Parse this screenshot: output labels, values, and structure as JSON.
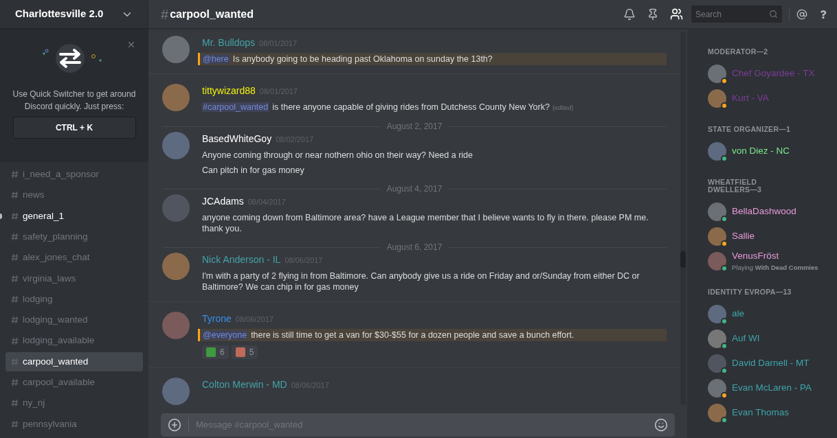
{
  "server": {
    "name": "Charlottesville 2.0"
  },
  "quick_switcher": {
    "text": "Use Quick Switcher to get around Discord quickly. Just press:",
    "shortcut": "CTRL + K"
  },
  "channels": [
    {
      "name": "i_need_a_sponsor",
      "selected": false,
      "unread": false
    },
    {
      "name": "news",
      "selected": false,
      "unread": false
    },
    {
      "name": "general_1",
      "selected": false,
      "unread": true
    },
    {
      "name": "safety_planning",
      "selected": false,
      "unread": false
    },
    {
      "name": "alex_jones_chat",
      "selected": false,
      "unread": false
    },
    {
      "name": "virginia_laws",
      "selected": false,
      "unread": false
    },
    {
      "name": "lodging",
      "selected": false,
      "unread": false
    },
    {
      "name": "lodging_wanted",
      "selected": false,
      "unread": false
    },
    {
      "name": "lodging_available",
      "selected": false,
      "unread": false
    },
    {
      "name": "carpool_wanted",
      "selected": true,
      "unread": false
    },
    {
      "name": "carpool_available",
      "selected": false,
      "unread": false
    },
    {
      "name": "ny_nj",
      "selected": false,
      "unread": false
    },
    {
      "name": "pennsylvania",
      "selected": false,
      "unread": false
    }
  ],
  "header": {
    "hash": "#",
    "channel": "carpool_wanted",
    "search_placeholder": "Search"
  },
  "messages": [
    {
      "kind": "message",
      "author": "Mr. Bulldops",
      "color": "#43a3a8",
      "timestamp": "08/01/2017",
      "lines": [
        {
          "mention": "@here",
          "text": "Is anybody going to be heading past Oklahoma on sunday the 13th?",
          "highlighted": true
        }
      ]
    },
    {
      "kind": "message",
      "author": "tittywizard88",
      "color": "#f2f20d",
      "timestamp": "08/01/2017",
      "lines": [
        {
          "mention": "#carpool_wanted",
          "text": "is there anyone capable of giving rides from Dutchess County New York?",
          "highlighted": false,
          "edited": "(edited)"
        }
      ]
    },
    {
      "kind": "divider",
      "date": "August 2, 2017"
    },
    {
      "kind": "message",
      "author": "BasedWhiteGoy",
      "color": "#ffffff",
      "timestamp": "08/02/2017",
      "lines": [
        {
          "text": "Anyone coming through or near nothern ohio on their way?  Need a ride",
          "highlighted": false
        },
        {
          "text": "Can pitch in for gas money",
          "highlighted": false
        }
      ]
    },
    {
      "kind": "divider",
      "date": "August 4, 2017"
    },
    {
      "kind": "message",
      "author": "JCAdams",
      "color": "#ffffff",
      "timestamp": "08/04/2017",
      "lines": [
        {
          "text": "anyone coming down from Baltimore area? have a League member that I believe wants to fly in there. please PM me. thank you.",
          "highlighted": false
        }
      ]
    },
    {
      "kind": "divider",
      "date": "August 6, 2017"
    },
    {
      "kind": "message",
      "author": "Nick Anderson - IL",
      "color": "#43a3a8",
      "timestamp": "08/06/2017",
      "lines": [
        {
          "text": "I'm with a party of 2 flying in from Baltimore. Can anybody  give us a ride on Friday and or/Sunday from either DC or Baltimore? We can chip in for gas money",
          "highlighted": false
        }
      ]
    },
    {
      "kind": "message",
      "author": "Tyrone",
      "color": "#3b8eea",
      "timestamp": "08/06/2017",
      "lines": [
        {
          "mention": "@everyone",
          "text": "there is still time to get a van for $30-$55 for a dozen people and save a bunch effort.",
          "highlighted": true
        }
      ],
      "reactions": [
        {
          "count": "6"
        },
        {
          "count": "5"
        }
      ]
    },
    {
      "kind": "message",
      "author": "Colton Merwin - MD",
      "color": "#43a3a8",
      "timestamp": "08/06/2017"
    }
  ],
  "composer": {
    "placeholder": "Message #carpool_wanted"
  },
  "member_groups": [
    {
      "title": "MODERATOR—2",
      "members": [
        {
          "name": "Chef Goyardee - TX",
          "color": "#7d3c98",
          "status": {
            "color": "#faa61a"
          }
        },
        {
          "name": "Kurt - VA",
          "color": "#7d3c98",
          "status": {
            "color": "#faa61a"
          }
        }
      ]
    },
    {
      "title": "STATE ORGANIZER—1",
      "members": [
        {
          "name": "von Diez - NC",
          "color": "#7bea8d",
          "status": {
            "color": "#43b581"
          }
        }
      ]
    },
    {
      "title": "WHEATFIELD DWELLERS—3",
      "members": [
        {
          "name": "BellaDashwood",
          "color": "#e89ad8",
          "status": {
            "color": "#43b581"
          }
        },
        {
          "name": "Sallie",
          "color": "#e89ad8",
          "status": {
            "color": "#faa61a"
          }
        },
        {
          "name": "VenusFröst",
          "color": "#e89ad8",
          "status": {
            "color": "#43b581"
          },
          "activity": "Playing **With Dead Commies**"
        }
      ]
    },
    {
      "title": "IDENTITY EVROPA—13",
      "members": [
        {
          "name": "ale",
          "color": "#3da6ab",
          "status": {
            "color": "#43b581"
          }
        },
        {
          "name": "Auf WI",
          "color": "#3da6ab",
          "status": {
            "color": "#43b581"
          }
        },
        {
          "name": "David Darnell - MT",
          "color": "#3da6ab",
          "status": {
            "color": "#43b581"
          }
        },
        {
          "name": "Evan McLaren - PA",
          "color": "#3da6ab",
          "status": {
            "color": "#faa61a"
          }
        },
        {
          "name": "Evan Thomas",
          "color": "#3da6ab",
          "status": {
            "color": "#43b581"
          }
        }
      ]
    }
  ]
}
